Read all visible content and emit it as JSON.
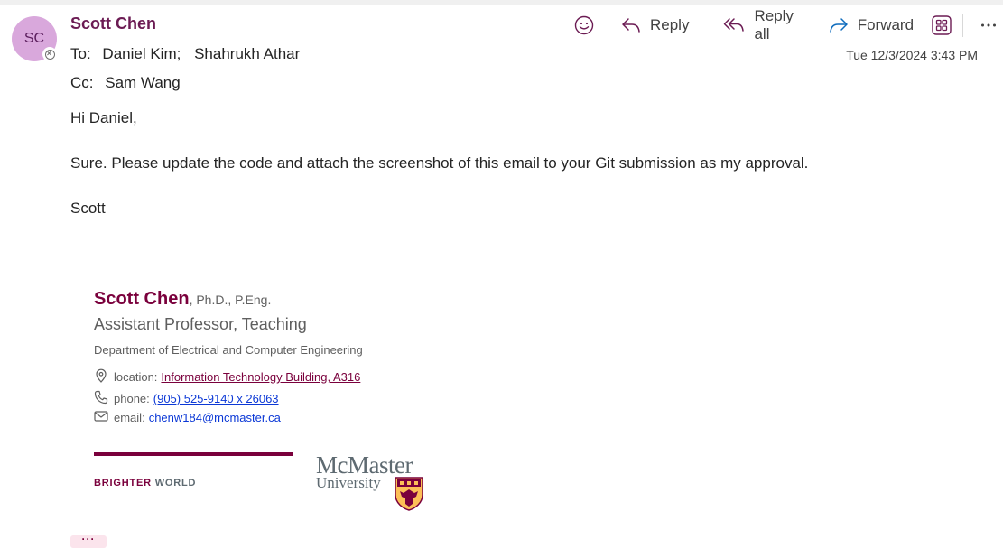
{
  "header": {
    "avatar_initials": "SC",
    "sender": "Scott Chen",
    "to_label": "To:",
    "to": [
      "Daniel Kim;",
      "Shahrukh Athar"
    ],
    "cc_label": "Cc:",
    "cc": [
      "Sam Wang"
    ],
    "date": "Tue 12/3/2024 3:43 PM"
  },
  "toolbar": {
    "emoji_icon": "emoji-icon",
    "reply_label": "Reply",
    "reply_all_label": "Reply all",
    "forward_label": "Forward",
    "apps_icon": "apps-grid-icon",
    "more_icon": "more-horizontal-icon"
  },
  "body": {
    "greeting": "Hi Daniel,",
    "message": "Sure.  Please update the code and attach the screenshot of this email to your Git submission as my approval.",
    "signoff": "Scott"
  },
  "signature": {
    "name": "Scott Chen",
    "credentials": ", Ph.D., P.Eng.",
    "title": "Assistant Professor, Teaching",
    "department": "Department of Electrical and Computer Engineering",
    "location_label": "location:",
    "location_value": "Information Technology Building, A316",
    "phone_label": "phone:",
    "phone_value": "(905) 525-9140 x 26063",
    "email_label": "email:",
    "email_value": "chenw184@mcmaster.ca",
    "brand_part1": "BRIGHTER",
    "brand_part2": "WORLD",
    "logo_top": "McMaster",
    "logo_bottom": "University"
  },
  "more_chip": "···",
  "colors": {
    "sender": "#6b1b53",
    "maroon": "#7a003c",
    "avatar_bg": "#d9a8dc",
    "link_blue": "#0b38d6"
  }
}
